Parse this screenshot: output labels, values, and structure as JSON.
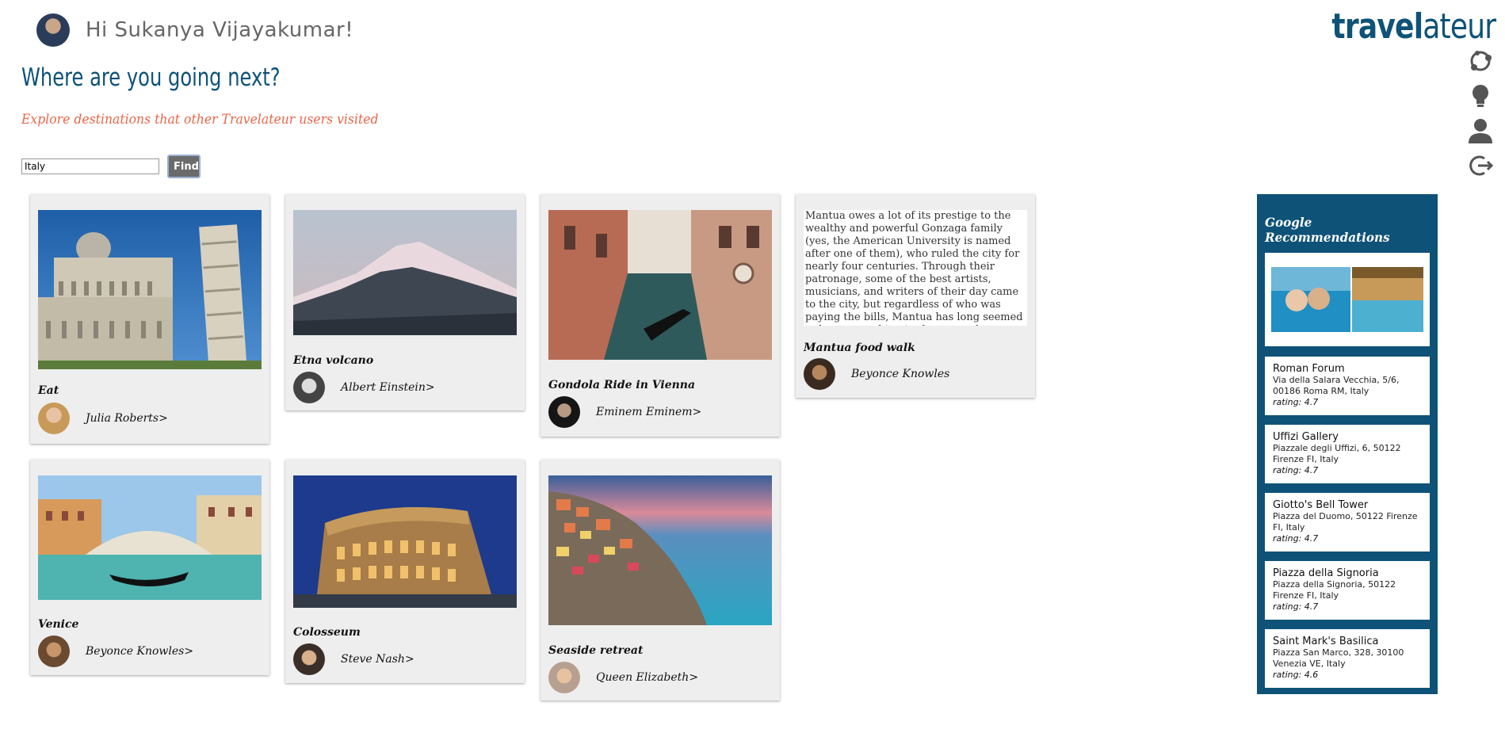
{
  "header": {
    "greeting": "Hi Sukanya Vijayakumar!",
    "headline": "Where are you going next?",
    "subheadline": "Explore destinations that other Travelateur users visited",
    "logo_part1": "travel",
    "logo_part2": "ateur"
  },
  "search": {
    "value": "Italy",
    "button_label": "Find"
  },
  "rail_icons": [
    "globe-icon",
    "lightbulb-icon",
    "user-icon",
    "logout-icon"
  ],
  "cards": [
    {
      "title": "Eat",
      "user": "Julia Roberts>"
    },
    {
      "title": "Etna volcano",
      "user": "Albert Einstein>"
    },
    {
      "title": "Gondola Ride in Vienna",
      "user": "Eminem Eminem>"
    },
    {
      "title": "Mantua food walk",
      "user": "Beyonce Knowles",
      "text": "Mantua owes a lot of its prestige to the wealthy and powerful Gonzaga family (yes, the American University is named after one of them), who ruled the city for nearly four centuries. Through their patronage, some of the best artists, musicians, and writers of their day came to the city, but regardless of who was paying the bills, Mantua has long seemed to have something in the water that inspired a"
    },
    {
      "title": "Venice",
      "user": "Beyonce Knowles>"
    },
    {
      "title": "Colosseum",
      "user": "Steve Nash>"
    },
    {
      "title": "Seaside retreat",
      "user": "Queen Elizabeth>"
    }
  ],
  "google": {
    "title": "Google Recommendations",
    "places": [
      {
        "name": "Roman Forum",
        "address": "Via della Salara Vecchia, 5/6, 00186 Roma RM, Italy",
        "rating": "rating: 4.7"
      },
      {
        "name": "Uffizi Gallery",
        "address": "Piazzale degli Uffizi, 6, 50122 Firenze FI, Italy",
        "rating": "rating: 4.7"
      },
      {
        "name": "Giotto's Bell Tower",
        "address": "Piazza del Duomo, 50122 Firenze FI, Italy",
        "rating": "rating: 4.7"
      },
      {
        "name": "Piazza della Signoria",
        "address": "Piazza della Signoria, 50122 Firenze FI, Italy",
        "rating": "rating: 4.7"
      },
      {
        "name": "Saint Mark's Basilica",
        "address": "Piazza San Marco, 328, 30100 Venezia VE, Italy",
        "rating": "rating: 4.6"
      }
    ]
  },
  "colors": {
    "brand": "#0e5278",
    "accent": "#e8664a"
  }
}
